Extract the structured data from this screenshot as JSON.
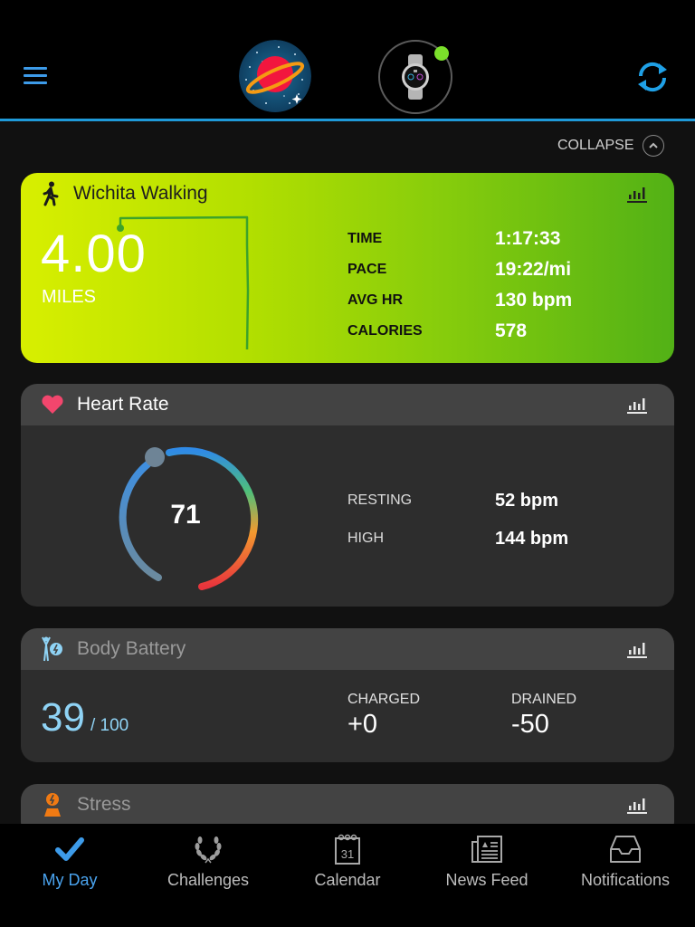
{
  "header": {
    "menu_icon": "hamburger-icon",
    "avatar_icon": "planet-avatar",
    "device_icon": "smartwatch-icon",
    "device_status_color": "#7be02b",
    "sync_icon": "sync-icon",
    "accent_color": "#1f9ad9"
  },
  "collapse": {
    "label": "COLLAPSE",
    "icon": "chevron-up-icon"
  },
  "activity": {
    "icon": "walking-icon",
    "title": "Wichita Walking",
    "distance": "4.00",
    "unit": "MILES",
    "stats": [
      {
        "label": "TIME",
        "value": "1:17:33"
      },
      {
        "label": "PACE",
        "value": "19:22/mi"
      },
      {
        "label": "AVG HR",
        "value": "130 bpm"
      },
      {
        "label": "CALORIES",
        "value": "578"
      }
    ]
  },
  "heart_rate": {
    "icon": "heart-icon",
    "title": "Heart Rate",
    "current": "71",
    "stats": [
      {
        "label": "RESTING",
        "value": "52 bpm"
      },
      {
        "label": "HIGH",
        "value": "144 bpm"
      }
    ]
  },
  "body_battery": {
    "icon": "body-battery-icon",
    "title": "Body Battery",
    "value": "39",
    "max": "/ 100",
    "charged_label": "CHARGED",
    "charged_value": "+0",
    "drained_label": "DRAINED",
    "drained_value": "-50"
  },
  "stress": {
    "icon": "stress-icon",
    "title": "Stress"
  },
  "tabs": [
    {
      "label": "My Day",
      "icon": "checkmark-icon",
      "active": true
    },
    {
      "label": "Challenges",
      "icon": "laurel-icon",
      "active": false
    },
    {
      "label": "Calendar",
      "icon": "calendar-icon",
      "active": false,
      "icon_text": "31"
    },
    {
      "label": "News Feed",
      "icon": "newspaper-icon",
      "active": false
    },
    {
      "label": "Notifications",
      "icon": "inbox-icon",
      "active": false
    }
  ]
}
